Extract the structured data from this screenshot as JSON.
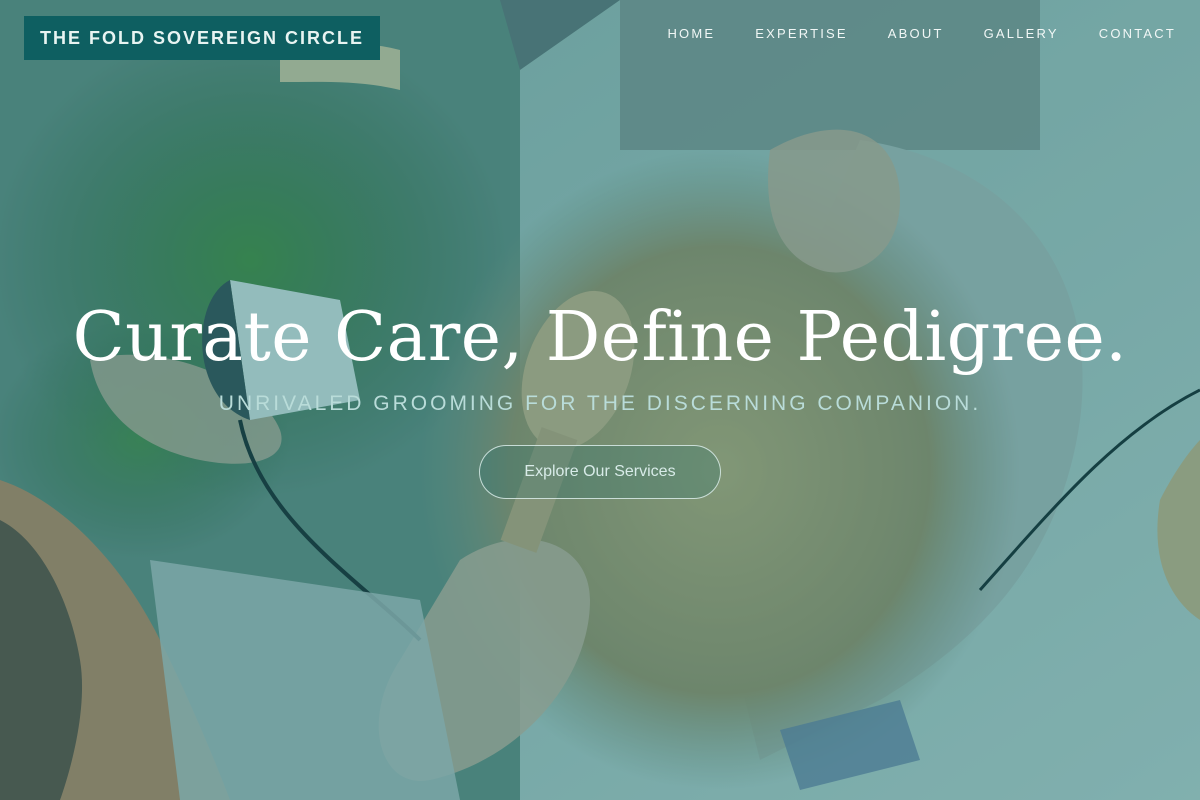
{
  "brand": {
    "name": "THE FOLD SOVEREIGN CIRCLE"
  },
  "nav": {
    "items": [
      {
        "label": "HOME"
      },
      {
        "label": "EXPERTISE"
      },
      {
        "label": "ABOUT"
      },
      {
        "label": "GALLERY"
      },
      {
        "label": "CONTACT"
      }
    ]
  },
  "hero": {
    "headline": "Curate Care, Define Pedigree.",
    "subheadline": "UNRIVALED GROOMING FOR THE DISCERNING COMPANION.",
    "cta_label": "Explore Our Services",
    "background_description_icon": "grooming-photo",
    "overlay_color": "#0c6e70"
  },
  "colors": {
    "brand_bg": "#0e5f61",
    "text_light": "#f1f7f6",
    "subheadline": "#b9dcd9"
  }
}
